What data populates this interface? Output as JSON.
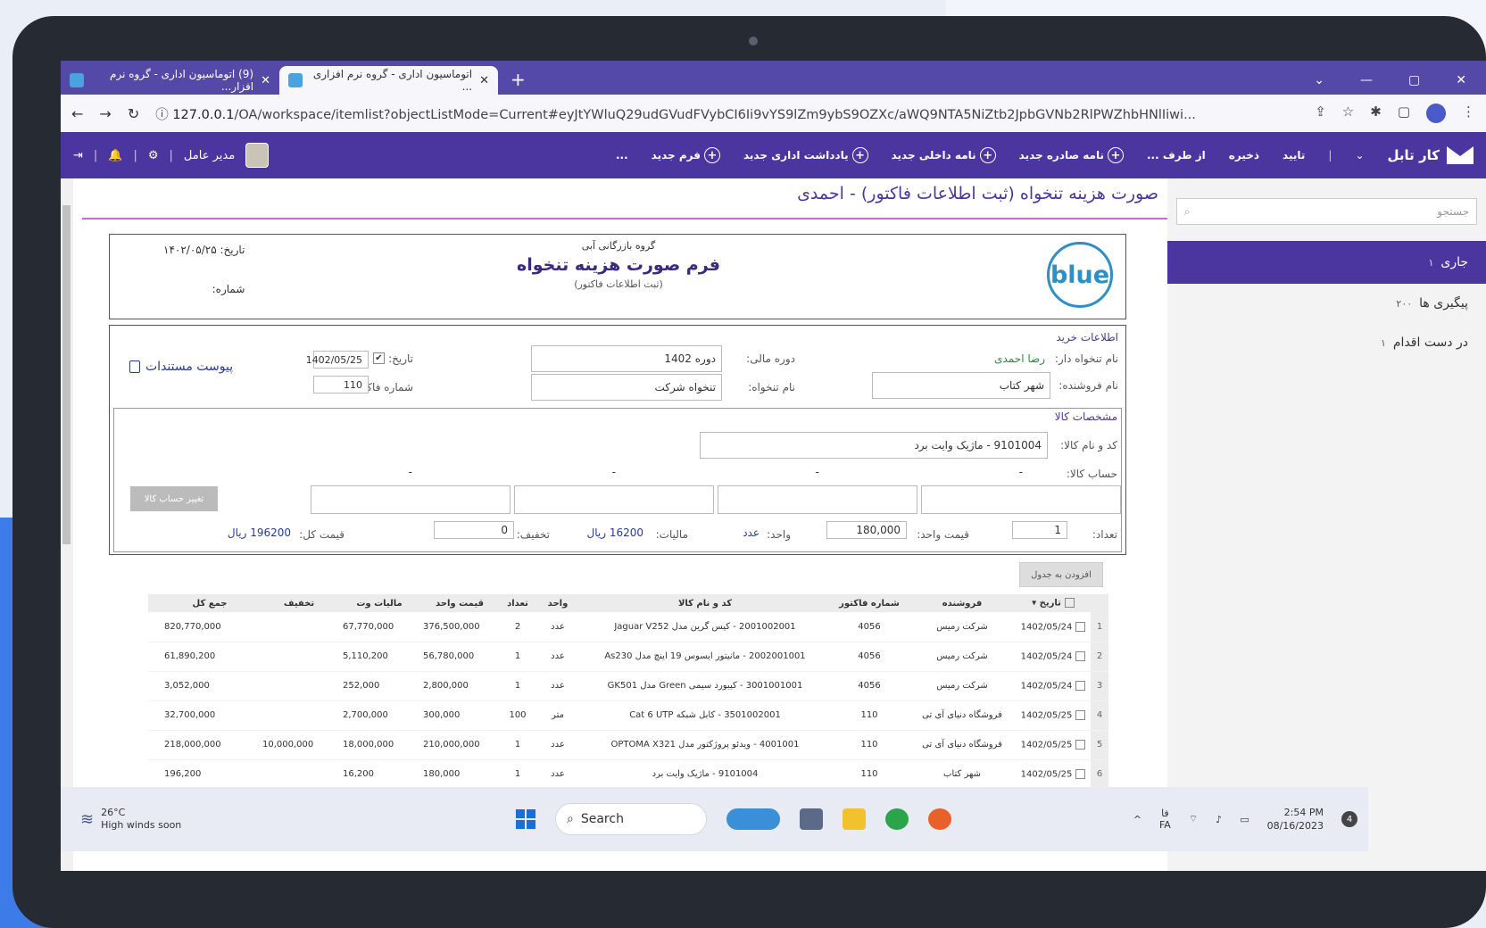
{
  "browser": {
    "tabs": [
      {
        "label": "(9) اتوماسیون اداری - گروه نرم افزار..."
      },
      {
        "label": "اتوماسیون اداری - گروه نرم افزاری ..."
      }
    ],
    "new_tab": "+",
    "url_prefix": "127.0.0.1",
    "url_rest": "/OA/workspace/itemlist?objectListMode=Current#eyJtYWluQ29udGVudFVybCI6Ii9vYS9lZm9ybS9OZXc/aWQ9NTA5NiZtb2JpbGVNb2RlPWZhbHNlIiwi..."
  },
  "toolbar": {
    "brand": "کار تابل",
    "approve": "تایید",
    "save": "ذخیره",
    "on_behalf": "از طرف ...",
    "outgoing_letter": "نامه صادره جدید",
    "internal_letter": "نامه داخلی جدید",
    "admin_note": "یادداشت اداری جدید",
    "new_form": "فرم جدید",
    "more": "...",
    "user": "مدیر عامل"
  },
  "sidebar": {
    "search_placeholder": "جستجو",
    "items": [
      {
        "label": "جاری",
        "count": "۱"
      },
      {
        "label": "پیگیری ها",
        "count": "۲۰۰"
      },
      {
        "label": "در دست اقدام",
        "count": "۱"
      }
    ]
  },
  "page": {
    "title": "صورت هزینه تنخواه (ثبت اطلاعات فاکتور) - احمدی"
  },
  "form_header": {
    "logo": "blue",
    "org": "گروه بازرگانی آبی",
    "title": "فرم صورت هزینه تنخواه",
    "subtitle": "(ثبت اطلاعات فاکتور)",
    "date_label": "تاریخ:",
    "date_value": "۱۴۰۲/۰۵/۲۵",
    "number_label": "شماره:"
  },
  "purchase": {
    "section_label": "اطلاعات خرید",
    "holder_label": "نام تنخواه دار:",
    "holder_value": "رضا احمدی",
    "vendor_label": "نام فروشنده:",
    "vendor_value": "شهر کتاب",
    "fiscal_label": "دوره مالی:",
    "fiscal_value": "دوره 1402",
    "petty_label": "نام تنخواه:",
    "petty_value": "تنخواه شرکت",
    "date_label": "تاریخ:",
    "date_value": "1402/05/25",
    "invoice_label": "شماره فاکتور:",
    "invoice_value": "110",
    "attach_label": "پیوست مستندات"
  },
  "spec": {
    "section_label": "مشخصات کالا",
    "item_label": "کد و نام کالا:",
    "item_value": "9101004 - ماژیک وایت برد",
    "account_label": "حساب کالا:",
    "dash": "-",
    "change_account": "تغییر حساب کالا",
    "qty_label": "تعداد:",
    "qty_value": "1",
    "unit_price_label": "قیمت واحد:",
    "unit_price_value": "180,000",
    "unit_label": "واحد:",
    "unit_value": "عدد",
    "tax_label": "مالیات:",
    "tax_value": "16200 ریال",
    "discount_label": "تخفیف:",
    "discount_value": "0",
    "total_label": "قیمت کل:",
    "total_value": "196200 ریال"
  },
  "add_button": "افزودن به جدول",
  "table": {
    "headers": [
      "تاریخ",
      "فروشنده",
      "شماره فاکتور",
      "کد و نام کالا",
      "واحد",
      "تعداد",
      "قیمت واحد",
      "مالیات وت",
      "تخفیف",
      "جمع کل"
    ],
    "rows": [
      {
        "n": "1",
        "date": "1402/05/24",
        "vendor": "شرکت رمیس",
        "invoice": "4056",
        "item": "2001002001 - کیس گرین مدل Jaguar V252",
        "unit": "عدد",
        "qty": "2",
        "price": "376,500,000",
        "tax": "67,770,000",
        "discount": "",
        "total": "820,770,000"
      },
      {
        "n": "2",
        "date": "1402/05/24",
        "vendor": "شرکت رمیس",
        "invoice": "4056",
        "item": "2002001001 - مانیتور ایسوس 19 اینچ مدل As230",
        "unit": "عدد",
        "qty": "1",
        "price": "56,780,000",
        "tax": "5,110,200",
        "discount": "",
        "total": "61,890,200"
      },
      {
        "n": "3",
        "date": "1402/05/24",
        "vendor": "شرکت رمیس",
        "invoice": "4056",
        "item": "3001001001 - کیبورد سیمی Green مدل GK501",
        "unit": "عدد",
        "qty": "1",
        "price": "2,800,000",
        "tax": "252,000",
        "discount": "",
        "total": "3,052,000"
      },
      {
        "n": "4",
        "date": "1402/05/25",
        "vendor": "فروشگاه دنیای آی تی",
        "invoice": "110",
        "item": "3501002001 - کابل شبکه Cat 6 UTP",
        "unit": "متر",
        "qty": "100",
        "price": "300,000",
        "tax": "2,700,000",
        "discount": "",
        "total": "32,700,000"
      },
      {
        "n": "5",
        "date": "1402/05/25",
        "vendor": "فروشگاه دنیای آی تی",
        "invoice": "110",
        "item": "4001001 - ویدئو پروژکتور مدل OPTOMA X321",
        "unit": "عدد",
        "qty": "1",
        "price": "210,000,000",
        "tax": "18,000,000",
        "discount": "10,000,000",
        "total": "218,000,000"
      },
      {
        "n": "6",
        "date": "1402/05/25",
        "vendor": "شهر کتاب",
        "invoice": "110",
        "item": "9101004 - ماژیک وایت برد",
        "unit": "عدد",
        "qty": "1",
        "price": "180,000",
        "tax": "16,200",
        "discount": "",
        "total": "196,200"
      }
    ]
  },
  "taskbar": {
    "temp": "26°C",
    "weather": "High winds soon",
    "search": "Search",
    "lang_top": "فا",
    "lang": "FA",
    "time": "2:54 PM",
    "date": "08/16/2023",
    "notif": "4"
  }
}
